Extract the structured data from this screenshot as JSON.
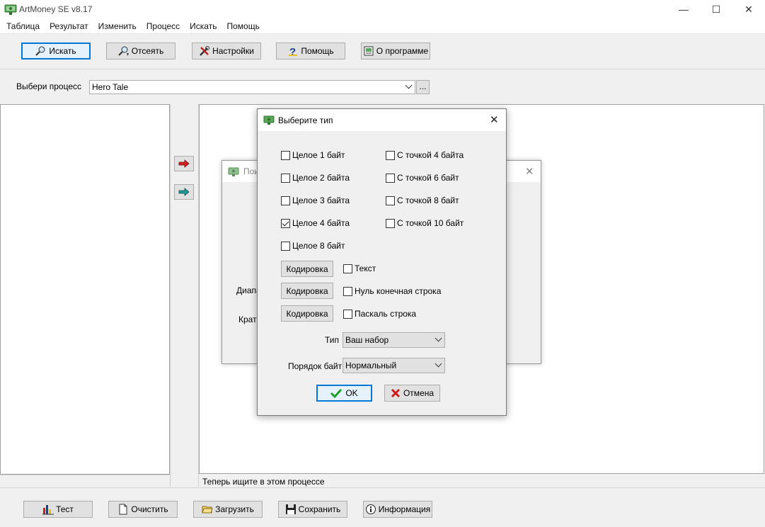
{
  "window": {
    "title": "ArtMoney SE v8.17",
    "minimize": "—",
    "maximize": "☐",
    "close": "✕"
  },
  "menu": [
    "Таблица",
    "Результат",
    "Изменить",
    "Процесс",
    "Искать",
    "Помощь"
  ],
  "toolbar": {
    "search": "Искать",
    "filter": "Отсеять",
    "settings": "Настройки",
    "help": "Помощь",
    "about": "О программе"
  },
  "process": {
    "label": "Выбери процесс",
    "value": "Hero Tale",
    "more": "..."
  },
  "status": "Теперь ищите в этом процессе",
  "bottom": {
    "test": "Тест",
    "clear": "Очистить",
    "load": "Загрузить",
    "save": "Сохранить",
    "info": "Информация"
  },
  "bg_dialog": {
    "title_fragment": "Пои",
    "label1": "Диапа",
    "label2": "Крат"
  },
  "dialog": {
    "title": "Выберите тип",
    "int_types": [
      {
        "label": "Целое 1 байт",
        "checked": false
      },
      {
        "label": "Целое 2 байта",
        "checked": false
      },
      {
        "label": "Целое 3 байта",
        "checked": false
      },
      {
        "label": "Целое 4 байта",
        "checked": true
      },
      {
        "label": "Целое 8 байт",
        "checked": false
      }
    ],
    "float_types": [
      {
        "label": "С точкой 4 байта",
        "checked": false
      },
      {
        "label": "С точкой 6 байт",
        "checked": false
      },
      {
        "label": "С точкой 8 байт",
        "checked": false
      },
      {
        "label": "С точкой 10 байт",
        "checked": false
      }
    ],
    "encoding_button": "Кодировка",
    "text_types": [
      {
        "label": "Текст",
        "checked": false
      },
      {
        "label": "Нуль конечная строка",
        "checked": false
      },
      {
        "label": "Паскаль строка",
        "checked": false
      }
    ],
    "type_label": "Тип",
    "type_value": "Ваш набор",
    "byte_order_label": "Порядок байт",
    "byte_order_value": "Нормальный",
    "ok": "OK",
    "cancel": "Отмена"
  },
  "colors": {
    "accent": "#0078d7",
    "arrow_red": "#d42020",
    "arrow_teal": "#1f9a9a",
    "ok_check": "#1e9e2a",
    "cancel_x": "#c81e1e"
  }
}
